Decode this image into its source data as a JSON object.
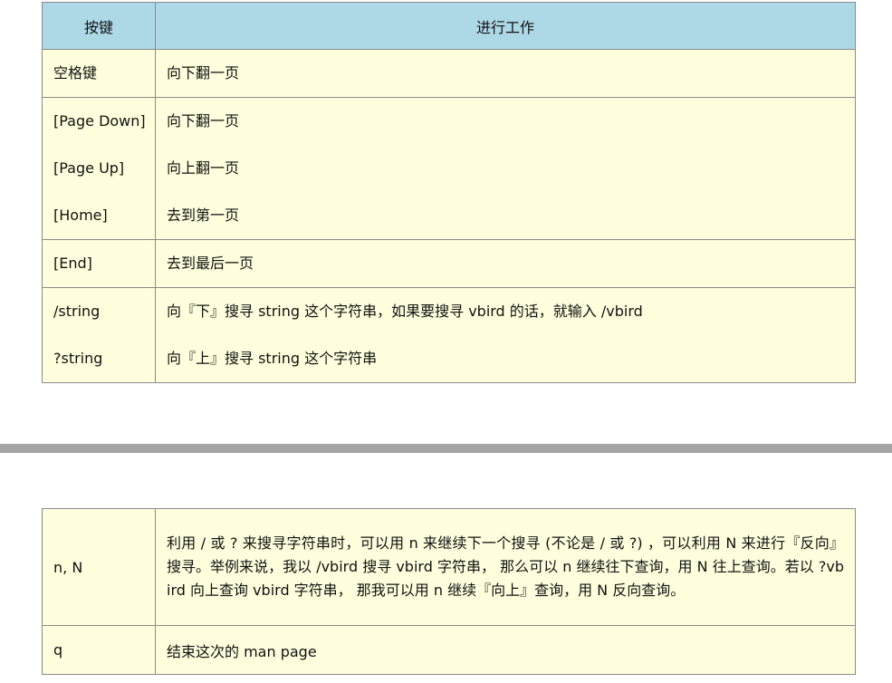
{
  "table_top": {
    "header": {
      "key": "按键",
      "action": "进行工作"
    },
    "rows": [
      {
        "keys": [
          "空格键"
        ],
        "actions": [
          "向下翻一页"
        ]
      },
      {
        "keys": [
          "[Page Down]",
          "[Page Up]",
          "[Home]"
        ],
        "actions": [
          "向下翻一页",
          "向上翻一页",
          "去到第一页"
        ]
      },
      {
        "keys": [
          "[End]"
        ],
        "actions": [
          "去到最后一页"
        ]
      },
      {
        "keys": [
          "/string",
          "?string"
        ],
        "actions": [
          "向『下』搜寻 string 这个字符串，如果要搜寻 vbird 的话，就输入 /vbird",
          "向『上』搜寻 string 这个字符串"
        ]
      }
    ]
  },
  "table_bottom": {
    "rows": [
      {
        "key": "n, N",
        "action": "利用 / 或 ? 来搜寻字符串时，可以用 n 来继续下一个搜寻 (不论是 / 或 ?) ，可以利用 N 来进行『反向』搜寻。举例来说，我以 /vbird 搜寻 vbird 字符串， 那么可以 n 继续往下查询，用 N 往上查询。若以 ?vbird 向上查询 vbird 字符串， 那我可以用 n 继续『向上』查询，用 N 反向查询。"
      },
      {
        "key": "q",
        "action": "结束这次的 man page"
      }
    ]
  }
}
